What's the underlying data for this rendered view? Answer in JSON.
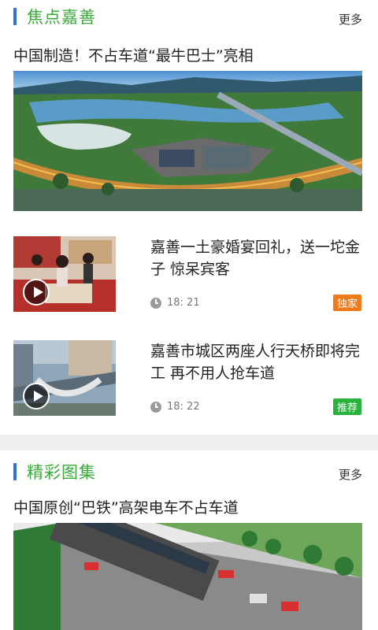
{
  "sections": [
    {
      "title": "焦点嘉善",
      "more": "更多",
      "headline": "中国制造！不占车道“最牛巴士”亮相",
      "news": [
        {
          "title": "嘉善一土豪婚宴回礼，送一坨金子 惊呆宾客",
          "time": "18: 21",
          "badge": "独家",
          "badge_color": "#ee7a1a"
        },
        {
          "title": "嘉善市城区两座人行天桥即将完工 再不用人抢车道",
          "time": "18: 22",
          "badge": "推荐",
          "badge_color": "#28b43c"
        }
      ]
    },
    {
      "title": "精彩图集",
      "more": "更多",
      "headline": "中国原创“巴铁”高架电车不占车道"
    }
  ],
  "colors": {
    "accent_bar": "#2f6fd6",
    "section_title": "#3ca83c"
  }
}
